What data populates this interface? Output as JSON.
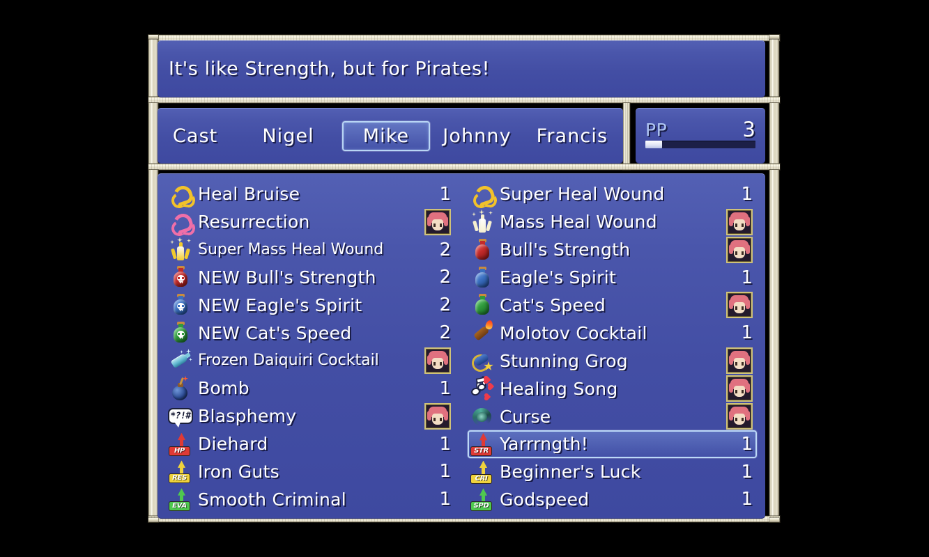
{
  "description": {
    "text": "It's like Strength, but for Pirates!"
  },
  "tabs": {
    "items": [
      {
        "label": "Cast",
        "selected": false
      },
      {
        "label": "Nigel",
        "selected": false
      },
      {
        "label": "Mike",
        "selected": true
      },
      {
        "label": "Johnny",
        "selected": false
      },
      {
        "label": "Francis",
        "selected": false
      }
    ]
  },
  "pp": {
    "label": "PP",
    "value": "3",
    "fill_percent": 15
  },
  "colors": {
    "panel_blue": "#434ea4",
    "frame_cream": "#e9e4cd",
    "selection_border": "#bcd9f8",
    "pp_label": "#aec4f2",
    "stat_hp": "#e03a35",
    "stat_res": "#efd23d",
    "stat_eva": "#4fc94f",
    "stat_str": "#e03a35",
    "stat_cri": "#efd23d",
    "stat_spd": "#4fc94f"
  },
  "list": {
    "left_column": [
      {
        "icon": "heal-rune-yellow-icon",
        "name": "Heal Bruise",
        "qty": "1",
        "portrait": false,
        "selected": false
      },
      {
        "icon": "heal-rune-pink-icon",
        "name": "Resurrection",
        "qty": "",
        "portrait": true,
        "selected": false
      },
      {
        "icon": "mass-heal-burst-icon",
        "name": "Super Mass Heal Wound",
        "qty": "2",
        "portrait": false,
        "selected": false,
        "compact": true
      },
      {
        "icon": "potion-red-skull-icon",
        "name": "NEW Bull's Strength",
        "qty": "2",
        "portrait": false,
        "selected": false
      },
      {
        "icon": "potion-blue-skull-icon",
        "name": "NEW Eagle's Spirit",
        "qty": "2",
        "portrait": false,
        "selected": false
      },
      {
        "icon": "potion-green-skull-icon",
        "name": "NEW Cat's Speed",
        "qty": "2",
        "portrait": false,
        "selected": false
      },
      {
        "icon": "frozen-cocktail-icon",
        "name": "Frozen Daiquiri Cocktail",
        "qty": "",
        "portrait": true,
        "selected": false,
        "compact": true
      },
      {
        "icon": "bomb-icon",
        "name": "Bomb",
        "qty": "1",
        "portrait": false,
        "selected": false
      },
      {
        "icon": "blasphemy-bubble-icon",
        "name": "Blasphemy",
        "qty": "",
        "portrait": true,
        "selected": false
      },
      {
        "icon": "stat-hp-up-icon",
        "name": "Diehard",
        "qty": "1",
        "portrait": false,
        "selected": false,
        "tag": "HP",
        "tag_color": "#e03a35"
      },
      {
        "icon": "stat-res-up-icon",
        "name": "Iron Guts",
        "qty": "1",
        "portrait": false,
        "selected": false,
        "tag": "RES",
        "tag_color": "#efd23d"
      },
      {
        "icon": "stat-eva-up-icon",
        "name": "Smooth Criminal",
        "qty": "1",
        "portrait": false,
        "selected": false,
        "tag": "EVA",
        "tag_color": "#4fc94f"
      }
    ],
    "right_column": [
      {
        "icon": "heal-rune-yellow-icon",
        "name": "Super Heal Wound",
        "qty": "1",
        "portrait": false,
        "selected": false
      },
      {
        "icon": "mass-heal-burst-white-icon",
        "name": "Mass Heal Wound",
        "qty": "",
        "portrait": true,
        "selected": false
      },
      {
        "icon": "potion-red-icon",
        "name": "Bull's Strength",
        "qty": "",
        "portrait": true,
        "selected": false
      },
      {
        "icon": "potion-blue-icon",
        "name": "Eagle's Spirit",
        "qty": "1",
        "portrait": false,
        "selected": false
      },
      {
        "icon": "potion-green-icon",
        "name": "Cat's Speed",
        "qty": "",
        "portrait": true,
        "selected": false
      },
      {
        "icon": "molotov-cocktail-icon",
        "name": "Molotov Cocktail",
        "qty": "1",
        "portrait": false,
        "selected": false
      },
      {
        "icon": "stunning-grog-icon",
        "name": "Stunning Grog",
        "qty": "",
        "portrait": true,
        "selected": false
      },
      {
        "icon": "healing-song-icon",
        "name": "Healing Song",
        "qty": "",
        "portrait": true,
        "selected": false
      },
      {
        "icon": "curse-swirl-icon",
        "name": "Curse",
        "qty": "",
        "portrait": true,
        "selected": false
      },
      {
        "icon": "stat-str-up-icon",
        "name": "Yarrrngth!",
        "qty": "1",
        "portrait": false,
        "selected": true,
        "tag": "STR",
        "tag_color": "#e03a35"
      },
      {
        "icon": "stat-cri-up-icon",
        "name": "Beginner's Luck",
        "qty": "1",
        "portrait": false,
        "selected": false,
        "tag": "CRI",
        "tag_color": "#efd23d"
      },
      {
        "icon": "stat-spd-up-icon",
        "name": "Godspeed",
        "qty": "1",
        "portrait": false,
        "selected": false,
        "tag": "SPD",
        "tag_color": "#4fc94f"
      }
    ]
  }
}
